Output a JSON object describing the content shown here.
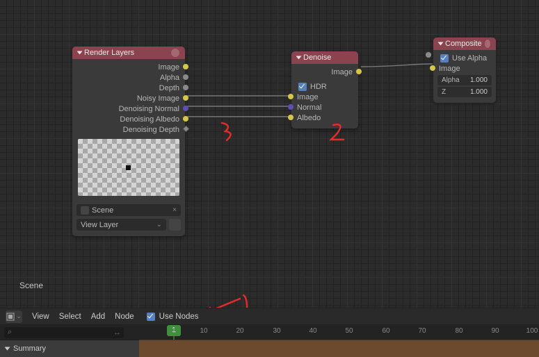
{
  "nodes": {
    "renderLayers": {
      "title": "Render Layers",
      "outputs": {
        "image": "Image",
        "alpha": "Alpha",
        "depth": "Depth",
        "noisy": "Noisy Image",
        "dnNormal": "Denoising Normal",
        "dnAlbedo": "Denoising Albedo",
        "dnDepth": "Denoising Depth"
      },
      "sceneField": "Scene",
      "layerField": "View Layer"
    },
    "denoise": {
      "title": "Denoise",
      "outputs": {
        "image": "Image"
      },
      "hdrLabel": "HDR",
      "inputs": {
        "image": "Image",
        "normal": "Normal",
        "albedo": "Albedo"
      }
    },
    "composite": {
      "title": "Composite",
      "useAlphaLabel": "Use Alpha",
      "inputs": {
        "image": "Image"
      },
      "alphaLabel": "Alpha",
      "alphaVal": "1.000",
      "zLabel": "Z",
      "zVal": "1.000"
    }
  },
  "sceneLabel": "Scene",
  "menu": {
    "view": "View",
    "select": "Select",
    "add": "Add",
    "node": "Node",
    "useNodes": "Use Nodes"
  },
  "timeline": {
    "ticks": [
      "1",
      "10",
      "20",
      "30",
      "40",
      "50",
      "60",
      "70",
      "80",
      "90",
      "100"
    ],
    "current": "1"
  },
  "summaryLabel": "Summary",
  "annotations": {
    "a1": "1",
    "a2": "2",
    "a3": "3"
  }
}
